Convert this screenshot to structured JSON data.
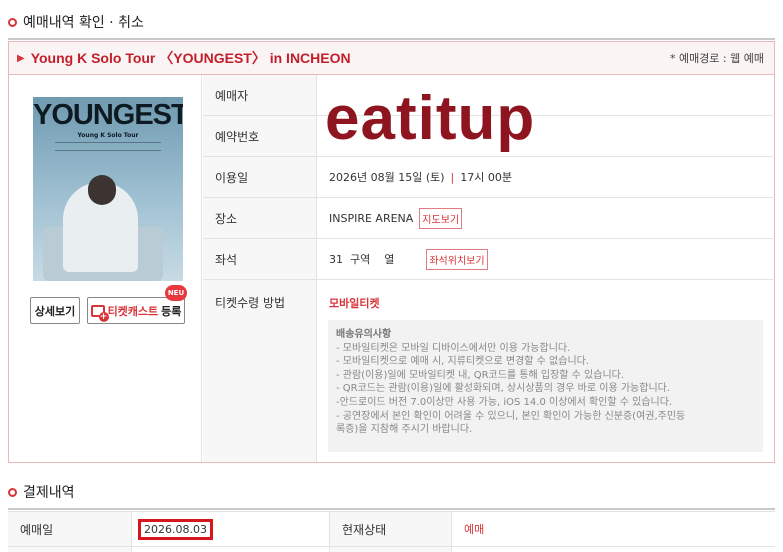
{
  "section1": {
    "title": "예매내역 확인 · 취소"
  },
  "show": {
    "name": "Young K Solo Tour 〈YOUNGEST〉 in INCHEON",
    "route": "* 예매경로 : 웹 예매"
  },
  "poster": {
    "title": "YOUNGEST",
    "subtitle": "Young K Solo Tour"
  },
  "buttons": {
    "detail": "상세보기",
    "ticketcast_red": "티켓캐스트",
    "ticketcast_rest": "등록",
    "new_badge": "NEU"
  },
  "rows": {
    "booker": {
      "label": "예매자"
    },
    "booking_no": {
      "label": "예약번호"
    },
    "date": {
      "label": "이용일",
      "day": "2026년 08월 15일 (토)",
      "time": "17시 00분"
    },
    "venue": {
      "label": "장소",
      "value": "INSPIRE ARENA",
      "map_btn": "지도보기"
    },
    "seat": {
      "label": "좌석",
      "value": "31  구역    열",
      "seat_btn": "좌석위치보기"
    },
    "ticket": {
      "label": "티켓수령 방법",
      "method": "모바일티켓"
    }
  },
  "notice": {
    "title": "배송유의사항",
    "lines": [
      "- 모바일티켓은 모바일 디바이스에서만 이용 가능합니다.",
      "- 모바일티켓으로 예매 시, 지류티켓으로 변경할 수 없습니다.",
      "- 관람(이용)일에 모바일티켓 내, QR코드를 통해 입장할 수 있습니다.",
      "- QR코드는 관람(이용)일에 활성화되며, 상시상품의 경우 바로 이용 가능합니다.",
      "-안드로이드 버전 7.0이상만 사용 가능, iOS 14.0 이상에서 확인할 수 있습니다.",
      "- 공연장에서 본인 확인이 어려울 수 있으니, 본인 확인이 가능한 신분증(여권,주민등",
      "록증)을 지참해 주시기 바랍니다."
    ]
  },
  "watermark": "eatitup",
  "section2": {
    "title": "결제내역"
  },
  "payment": {
    "booking_date_label": "예매일",
    "booking_date": "2026.08.03",
    "status_label": "현재상태",
    "status": "예매"
  },
  "colors": {
    "accent": "#d9343a",
    "watermark": "#8e1520"
  }
}
